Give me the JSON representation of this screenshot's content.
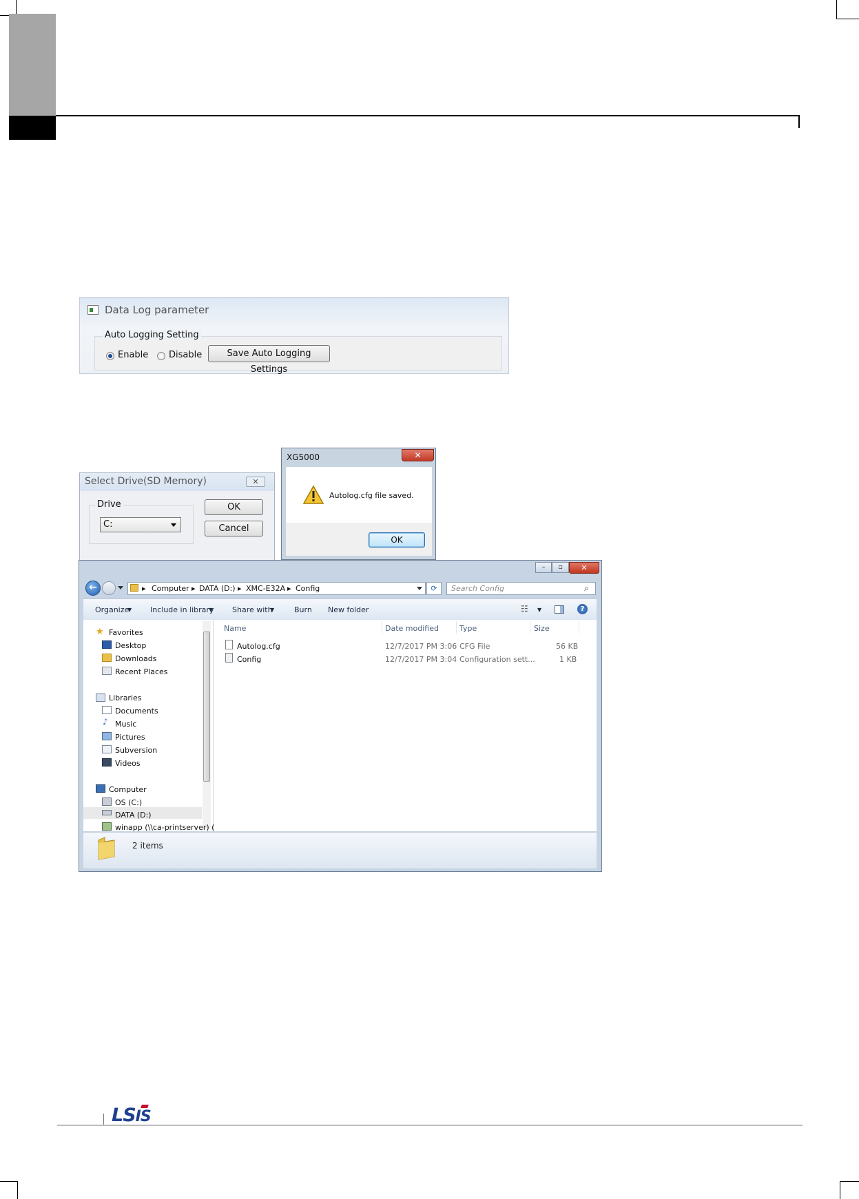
{
  "data_log_dialog": {
    "title": "Data Log parameter",
    "group_label": "Auto Logging Setting",
    "radio_enable": "Enable",
    "radio_disable": "Disable",
    "save_button": "Save Auto Logging Settings"
  },
  "select_drive_dialog": {
    "title": "Select Drive(SD Memory)",
    "group_label": "Drive",
    "drive_value": "C:",
    "ok_button": "OK",
    "cancel_button": "Cancel"
  },
  "message_box": {
    "title": "XG5000",
    "message": "Autolog.cfg file saved.",
    "ok_button": "OK"
  },
  "explorer": {
    "address": [
      "Computer",
      "DATA (D:)",
      "XMC-E32A",
      "Config"
    ],
    "search_placeholder": "Search Config",
    "toolbar": {
      "organize": "Organize",
      "include_in_library": "Include in library",
      "share_with": "Share with",
      "burn": "Burn",
      "new_folder": "New folder"
    },
    "nav": {
      "favorites": "Favorites",
      "desktop": "Desktop",
      "downloads": "Downloads",
      "recent_places": "Recent Places",
      "libraries": "Libraries",
      "documents": "Documents",
      "music": "Music",
      "pictures": "Pictures",
      "subversion": "Subversion",
      "videos": "Videos",
      "computer": "Computer",
      "os_c": "OS (C:)",
      "data_d": "DATA (D:)",
      "winapp": "winapp (\\\\ca-printserver) ("
    },
    "columns": {
      "name": "Name",
      "date_modified": "Date modified",
      "type": "Type",
      "size": "Size"
    },
    "files": [
      {
        "name": "Autolog.cfg",
        "date": "12/7/2017 PM 3:06",
        "type": "CFG File",
        "size": "56 KB"
      },
      {
        "name": "Config",
        "date": "12/7/2017 PM 3:04",
        "type": "Configuration sett...",
        "size": "1 KB"
      }
    ],
    "status": "2 items"
  },
  "footer": {
    "logo_ls": "LS",
    "logo_is": "IS"
  },
  "colors": {
    "brand_blue": "#1f3f8f",
    "brand_red": "#c8102e"
  }
}
